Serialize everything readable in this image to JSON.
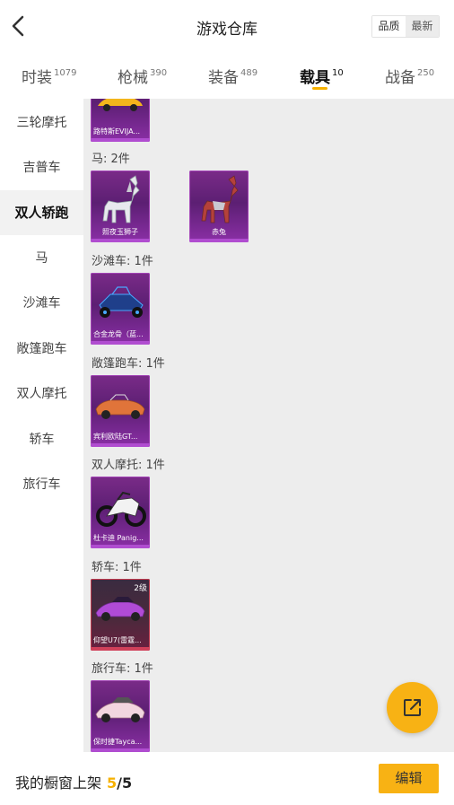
{
  "header": {
    "title": "游戏仓库",
    "sort": [
      "品质",
      "最新"
    ]
  },
  "tabs": [
    {
      "label": "时装",
      "count": "1079"
    },
    {
      "label": "枪械",
      "count": "390"
    },
    {
      "label": "装备",
      "count": "489"
    },
    {
      "label": "载具",
      "count": "10"
    },
    {
      "label": "战备",
      "count": "250"
    }
  ],
  "sidebar": [
    "三轮摩托",
    "吉普车",
    "双人轿跑",
    "马",
    "沙滩车",
    "敞篷跑车",
    "双人摩托",
    "轿车",
    "旅行车"
  ],
  "sections": [
    {
      "label": "",
      "items": [
        {
          "name": "路特斯EVIJA...",
          "icon": "yellow-sports-car-icon"
        }
      ]
    },
    {
      "label": "马: 2件",
      "items": [
        {
          "name": "照夜玉狮子",
          "icon": "white-horse-icon"
        },
        {
          "name": "赤兔",
          "icon": "red-horse-icon"
        }
      ]
    },
    {
      "label": "沙滩车: 1件",
      "items": [
        {
          "name": "合金龙骨（蓝...",
          "icon": "blue-buggy-icon"
        }
      ]
    },
    {
      "label": "敞篷跑车: 1件",
      "items": [
        {
          "name": "宾利欧陆GT...",
          "icon": "orange-convertible-icon"
        }
      ]
    },
    {
      "label": "双人摩托: 1件",
      "items": [
        {
          "name": "杜卡迪 Panig...",
          "icon": "motorcycle-icon"
        }
      ]
    },
    {
      "label": "轿车: 1件",
      "items": [
        {
          "name": "仰望U7(雷霆...",
          "icon": "purple-sedan-icon",
          "level": "2级"
        }
      ]
    },
    {
      "label": "旅行车: 1件",
      "items": [
        {
          "name": "保时捷Tayca...",
          "icon": "pink-car-icon"
        }
      ]
    }
  ],
  "footer": {
    "label": "我的橱窗上架",
    "count": "5",
    "sep": "/",
    "total": "5",
    "edit": "编辑"
  },
  "colors": {
    "accent": "#f8b214",
    "card_purple": "#7a2b88",
    "card_red": "#6a2040"
  }
}
